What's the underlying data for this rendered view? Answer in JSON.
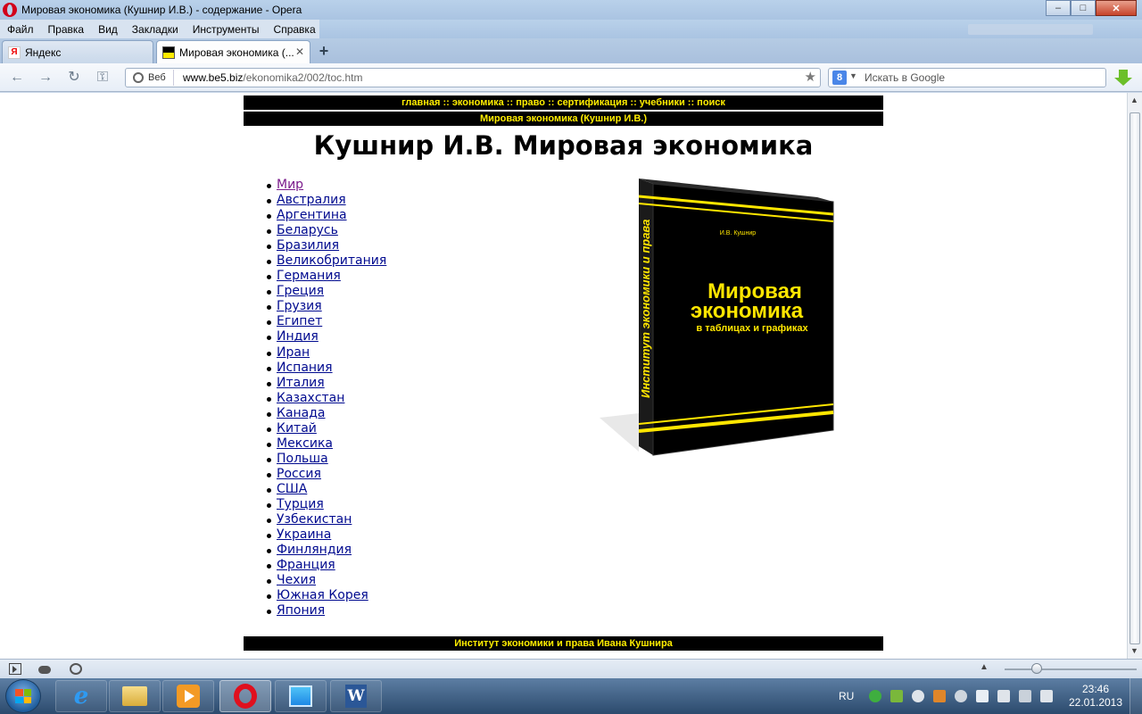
{
  "window": {
    "title": "Мировая экономика (Кушнир И.В.) - содержание - Opera",
    "controls": {
      "minimize": "–",
      "maximize": "□",
      "close": "✕"
    }
  },
  "menu": [
    "Файл",
    "Правка",
    "Вид",
    "Закладки",
    "Инструменты",
    "Справка"
  ],
  "tabs": [
    {
      "label": "Яндекс",
      "favicon": "yandex-favicon",
      "active": false
    },
    {
      "label": "Мировая экономика (...",
      "favicon": "be5-favicon",
      "active": true
    }
  ],
  "new_tab_label": "+",
  "addressbar": {
    "site_button": "Веб",
    "url_host": "www.be5.biz",
    "url_path": "/ekonomika2/002/toc.htm"
  },
  "searchbar": {
    "engine_icon": "8",
    "placeholder": "Искать в Google"
  },
  "page": {
    "top_nav": "главная :: экономика :: право :: сертификация :: учебники :: поиск",
    "subheader": "Мировая экономика (Кушнир И.В.)",
    "heading": "Кушнир И.В. Мировая экономика",
    "countries": [
      "Мир",
      "Австралия",
      "Аргентина",
      "Беларусь",
      "Бразилия",
      "Великобритания",
      "Германия",
      "Греция",
      "Грузия",
      "Египет",
      "Индия",
      "Иран",
      "Испания",
      "Италия",
      "Казахстан",
      "Канада",
      "Китай",
      "Мексика",
      "Польша",
      "Россия",
      "США",
      "Турция",
      "Узбекистан",
      "Украина",
      "Финляндия",
      "Франция",
      "Чехия",
      "Южная Корея",
      "Япония"
    ],
    "visited_index": 0,
    "footer": "Институт экономики и права Ивана Кушнира",
    "book": {
      "author": "И.В. Кушнир",
      "title_line1": "Мировая",
      "title_line2": "экономика",
      "subtitle": "в таблицах и графиках",
      "spine": "Институт экономики и права"
    }
  },
  "taskbar": {
    "language": "RU",
    "time": "23:46",
    "date": "22.01.2013"
  },
  "colors": {
    "link": "#000a8f",
    "visited": "#7a1a8b",
    "banner_bg": "#000000",
    "banner_text": "#ffed00"
  }
}
